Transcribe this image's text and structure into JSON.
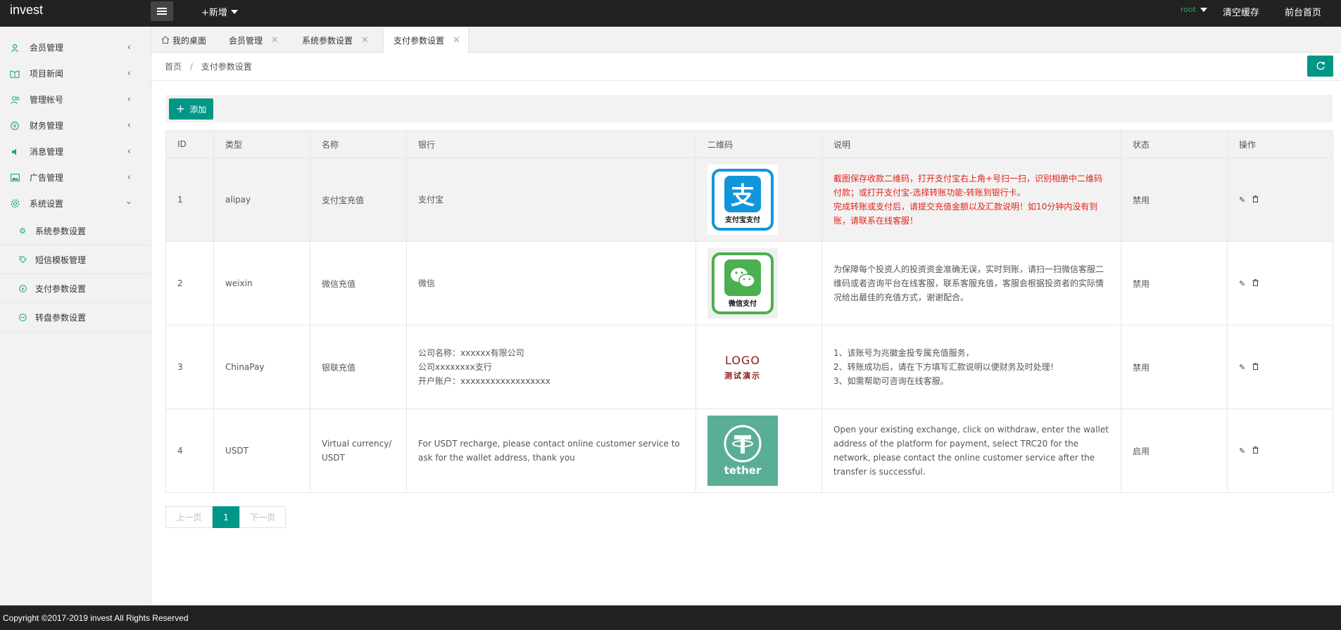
{
  "app": {
    "title": "invest"
  },
  "topbar": {
    "new_label": "+新增",
    "user": "root",
    "clear_cache": "清空缓存",
    "front_home": "前台首页"
  },
  "sidebar": {
    "items": [
      {
        "label": "会员管理",
        "icon": "user-icon"
      },
      {
        "label": "项目新闻",
        "icon": "book-icon"
      },
      {
        "label": "管理帐号",
        "icon": "admin-icon"
      },
      {
        "label": "财务管理",
        "icon": "yen-icon"
      },
      {
        "label": "消息管理",
        "icon": "speaker-icon"
      },
      {
        "label": "广告管理",
        "icon": "image-icon"
      },
      {
        "label": "系统设置",
        "icon": "gear-icon"
      }
    ],
    "sub_items": [
      {
        "label": "系统参数设置",
        "icon": "settings-icon"
      },
      {
        "label": "短信模板管理",
        "icon": "tag-icon"
      },
      {
        "label": "支付参数设置",
        "icon": "payment-icon"
      },
      {
        "label": "转盘参数设置",
        "icon": "wheel-icon"
      }
    ]
  },
  "tabs": [
    {
      "label": "我的桌面"
    },
    {
      "label": "会员管理"
    },
    {
      "label": "系统参数设置"
    },
    {
      "label": "支付参数设置"
    }
  ],
  "breadcrumb": {
    "home": "首页",
    "current": "支付参数设置"
  },
  "toolbar": {
    "add_label": "添加"
  },
  "table": {
    "headers": [
      "ID",
      "类型",
      "名称",
      "银行",
      "二维码",
      "说明",
      "状态",
      "操作"
    ],
    "rows": [
      {
        "id": "1",
        "type": "alipay",
        "name": "支付宝充值",
        "bank": [
          "支付宝"
        ],
        "qr_label": "支付宝支付",
        "desc": [
          "截图保存收款二维码，打开支付宝右上角+号扫一扫，识别相册中二维码付款；或打开支付宝-选择转账功能-转账到银行卡。",
          "完成转账或支付后，请提交充值金额以及汇款说明！如10分钟内没有到账，请联系在线客服！"
        ],
        "status": "禁用"
      },
      {
        "id": "2",
        "type": "weixin",
        "name": "微信充值",
        "bank": [
          "微信"
        ],
        "qr_label": "微信支付",
        "desc": [
          "为保障每个投资人的投资资金准确无误，实时到账，请扫一扫微信客服二维码或者咨询平台在线客服，联系客服充值，客服会根据投资者的实际情况给出最佳的充值方式，谢谢配合。"
        ],
        "status": "禁用"
      },
      {
        "id": "3",
        "type": "ChinaPay",
        "name": "银联充值",
        "bank": [
          "公司名称：xxxxxx有限公司",
          "公司xxxxxxxx支行",
          "开户账户：xxxxxxxxxxxxxxxxxx"
        ],
        "qr_title": "LOGO",
        "qr_sub": "测试演示",
        "desc": [
          "1、该账号为兆徽金投专属充值服务，",
          "2、转账成功后，请在下方填写汇款说明以便财务及时处理！",
          "3、如需帮助可咨询在线客服。"
        ],
        "status": "禁用"
      },
      {
        "id": "4",
        "type": "USDT",
        "name": "Virtual currency/USDT",
        "bank": [
          "For USDT recharge, please contact online customer service to ask for the wallet address, thank you"
        ],
        "qr_label": "tether",
        "desc": [
          "Open your existing exchange, click on withdraw, enter the wallet address of the platform for payment, select TRC20 for the network, please contact the online customer service after the transfer is successful."
        ],
        "status": "启用"
      }
    ]
  },
  "pager": {
    "prev": "上一页",
    "current": "1",
    "next": "下一页"
  },
  "footer": {
    "text": "Copyright ©2017-2019 invest All Rights Reserved"
  },
  "colors": {
    "accent": "#009688",
    "topbar": "#222222",
    "danger_text": "#e2231a"
  }
}
